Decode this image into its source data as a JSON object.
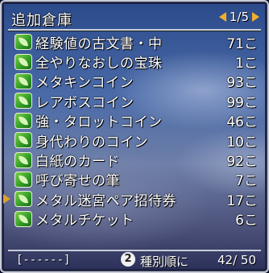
{
  "title": "追加倉庫",
  "pager": {
    "current": "1",
    "total": "5",
    "text": "1/5"
  },
  "items": [
    {
      "name": "経験値の古文書・中",
      "qty": "71こ"
    },
    {
      "name": "全やりなおしの宝珠",
      "qty": "1こ"
    },
    {
      "name": "メタキンコイン",
      "qty": "93こ"
    },
    {
      "name": "レアボスコイン",
      "qty": "99こ"
    },
    {
      "name": "強・タロットコイン",
      "qty": "46こ"
    },
    {
      "name": "身代わりのコイン",
      "qty": "10こ"
    },
    {
      "name": "白紙のカード",
      "qty": "92こ"
    },
    {
      "name": "呼び寄せの筆",
      "qty": "7こ"
    },
    {
      "name": "メタル迷宮ペア招待券",
      "qty": "17こ"
    },
    {
      "name": "メタルチケット",
      "qty": "6こ"
    }
  ],
  "cursor_row": 8,
  "footer": {
    "filter": "[------]",
    "button_glyph": "2",
    "sort_label": "種別順に",
    "count": "42/ 50"
  },
  "colors": {
    "accent": "#f0b02a",
    "leaf": "#2f9a24"
  }
}
